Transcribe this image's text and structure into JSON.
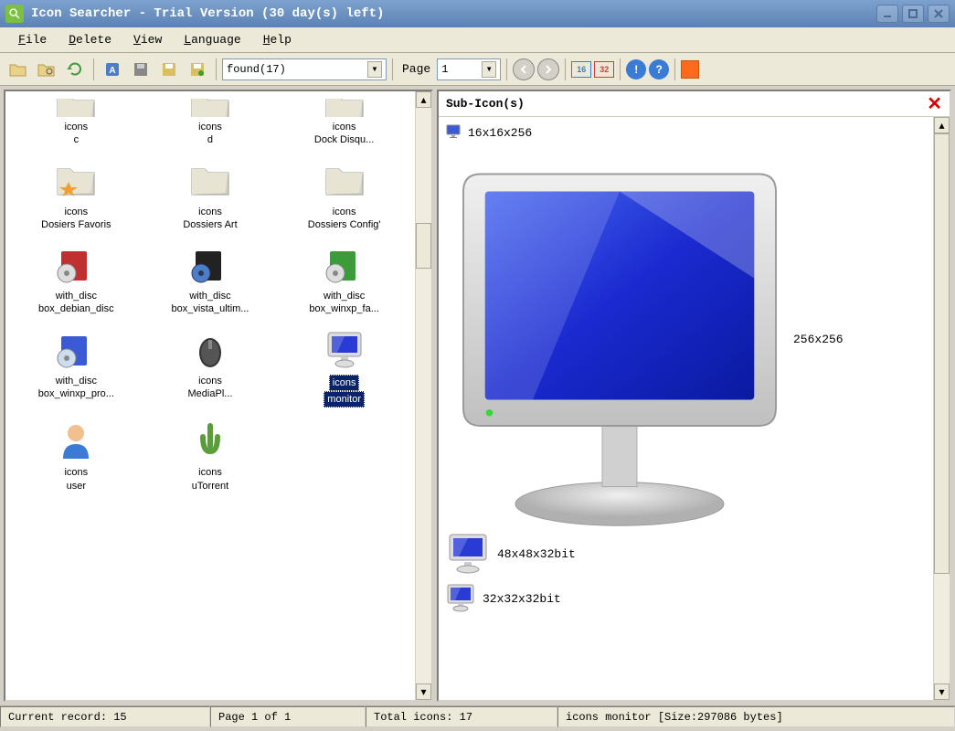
{
  "title": "Icon Searcher - Trial Version (30 day(s) left)",
  "menu": {
    "file": "File",
    "delete": "Delete",
    "view": "View",
    "language": "Language",
    "help": "Help"
  },
  "toolbar": {
    "search_value": "found(17)",
    "page_label": "Page",
    "page_value": "1",
    "size16": "16",
    "size32": "32"
  },
  "icons": [
    [
      {
        "l1": "icons",
        "l2": "c",
        "kind": "folder-cut"
      },
      {
        "l1": "icons",
        "l2": "d",
        "kind": "folder-cut"
      },
      {
        "l1": "icons",
        "l2": "Dock Disqu...",
        "kind": "folder-cut"
      }
    ],
    [
      {
        "l1": "icons",
        "l2": "Dosiers Favoris",
        "kind": "folder-fav"
      },
      {
        "l1": "icons",
        "l2": "Dossiers Art",
        "kind": "folder-art"
      },
      {
        "l1": "icons",
        "l2": "Dossiers Config'",
        "kind": "folder-cfg"
      }
    ],
    [
      {
        "l1": "with_disc",
        "l2": "box_debian_disc",
        "kind": "box-red"
      },
      {
        "l1": "with_disc",
        "l2": "box_vista_ultim...",
        "kind": "box-black"
      },
      {
        "l1": "with_disc",
        "l2": "box_winxp_fa...",
        "kind": "box-green"
      }
    ],
    [
      {
        "l1": "with_disc",
        "l2": "box_winxp_pro...",
        "kind": "box-blue"
      },
      {
        "l1": "icons",
        "l2": "MediaPl...",
        "kind": "mouse"
      },
      {
        "l1": "icons",
        "l2": "monitor",
        "kind": "monitor",
        "selected": true
      }
    ],
    [
      {
        "l1": "icons",
        "l2": "user",
        "kind": "user"
      },
      {
        "l1": "icons",
        "l2": "uTorrent",
        "kind": "utorrent"
      },
      null
    ]
  ],
  "sub": {
    "title": "Sub-Icon(s)",
    "size_16": "16x16x256",
    "size_256": "256x256",
    "size_48": "48x48x32bit",
    "size_32": "32x32x32bit"
  },
  "status": {
    "record": "Current record: 15",
    "page": "Page 1 of 1",
    "total": "Total icons: 17",
    "file": "icons monitor [Size:297086 bytes]"
  }
}
